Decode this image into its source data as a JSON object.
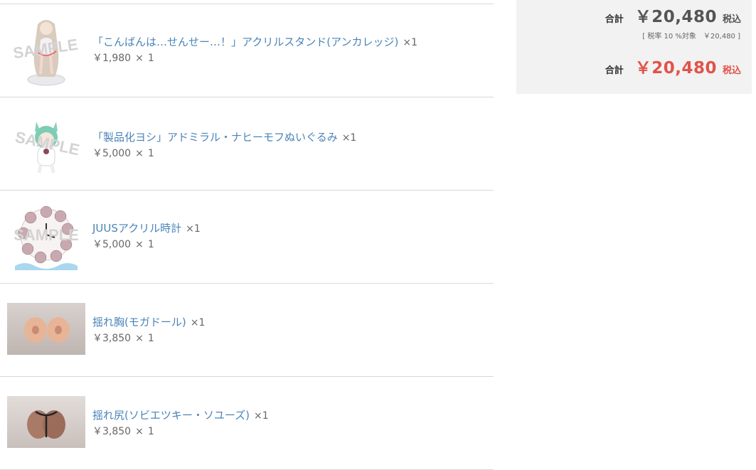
{
  "items": [
    {
      "name": "「こんばんは…せんせー…！」アクリルスタンド(アンカレッジ)",
      "qty": "×1",
      "price": "￥1,980",
      "times": "×",
      "count": "1",
      "sample": "SAMPLE"
    },
    {
      "name": "「製品化ヨシ」アドミラル・ナヒーモフぬいぐるみ",
      "qty": "×1",
      "price": "￥5,000",
      "times": "×",
      "count": "1",
      "sample": "SAMPLE"
    },
    {
      "name": "JUUSアクリル時計",
      "qty": "×1",
      "price": "￥5,000",
      "times": "×",
      "count": "1",
      "sample": "SAMPLE"
    },
    {
      "name": "揺れ胸(モガドール)",
      "qty": "×1",
      "price": "￥3,850",
      "times": "×",
      "count": "1"
    },
    {
      "name": "揺れ尻(ソビエツキー・ソユーズ)",
      "qty": "×1",
      "price": "￥3,850",
      "times": "×",
      "count": "1"
    }
  ],
  "summary": {
    "total_label": "合計",
    "total_value": "￥20,480",
    "tax_included": "税込",
    "breakdown": "[ 税率 10 %対象　￥20,480 ]",
    "grand_label": "合計",
    "grand_value": "￥20,480",
    "grand_tax_included": "税込"
  },
  "colors": {
    "link": "#4a84b8",
    "accent": "#e0544a",
    "panel": "#f2f2f2"
  }
}
